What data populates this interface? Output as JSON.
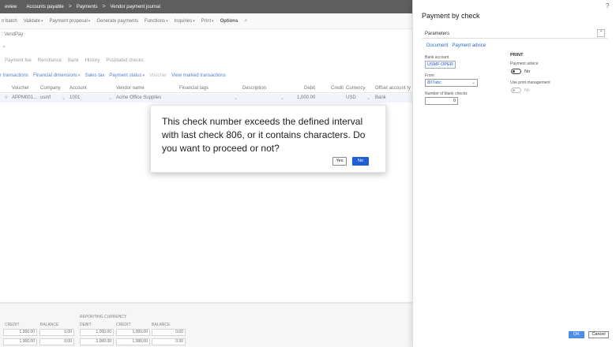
{
  "topbar": {
    "items": [
      "eview",
      "Accounts payable",
      "Payments",
      "Vendor payment journal"
    ],
    "separator": ">"
  },
  "actionpane": {
    "items": [
      "n batch",
      "Validate",
      "Payment proposal",
      "Generate payments",
      "Functions",
      "Inquiries",
      "Print"
    ],
    "options": "Options"
  },
  "page": {
    "crumb": ": VendPay"
  },
  "tabs": [
    "Payment fee",
    "Remittance",
    "Bank",
    "History",
    "Postdated checks"
  ],
  "lines_actions": [
    "r transactions",
    "Financial dimensions",
    "Sales tax",
    "Payment status",
    "Voucher",
    "View marked transactions"
  ],
  "grid": {
    "headers": [
      "Voucher",
      "Company",
      "Account",
      "Vendor name",
      "Financial tags",
      "Description",
      "Debit",
      "Credit",
      "Currency",
      "Offset account ty"
    ],
    "row": {
      "voucher": "APPM001...",
      "company": "usmf",
      "account": "1001",
      "vendor_name": "Acme Office Supplies",
      "debit": "1,000.00",
      "currency": "USD",
      "offset": "Bank"
    }
  },
  "totals": {
    "reporting_currency": "REPORTING CURRENCY",
    "labels": [
      "CREDIT",
      "BALANCE",
      "DEBIT",
      "CREDIT",
      "BALANCE"
    ],
    "row1": [
      "1,000.00",
      "0.00",
      "1,000.00",
      "1,000.00",
      "0.00"
    ],
    "row2": [
      "1,000.00",
      "0.00",
      "1,000.00",
      "1,000.00",
      "0.00"
    ]
  },
  "modal": {
    "message": "This check number exceeds the defined interval with last check 806, or it contains characters. Do you want to proceed or not?",
    "yes": "Yes",
    "no": "No"
  },
  "panel": {
    "title": "Payment by check",
    "help": "?",
    "section": "Parameters",
    "subtabs": [
      "Document",
      "Payment advice"
    ],
    "bank_account_label": "Bank account",
    "bank_account": "USMF OPER",
    "from_label": "From",
    "from_value": "807abc",
    "blank_checks_label": "Number of blank checks",
    "blank_checks": "0",
    "print_heading": "PRINT",
    "payment_advice_label": "Payment advice",
    "payment_advice_value": "No",
    "print_mgmt_label": "Use print management",
    "print_mgmt_value": "No",
    "ok": "OK",
    "cancel": "Cancel"
  }
}
